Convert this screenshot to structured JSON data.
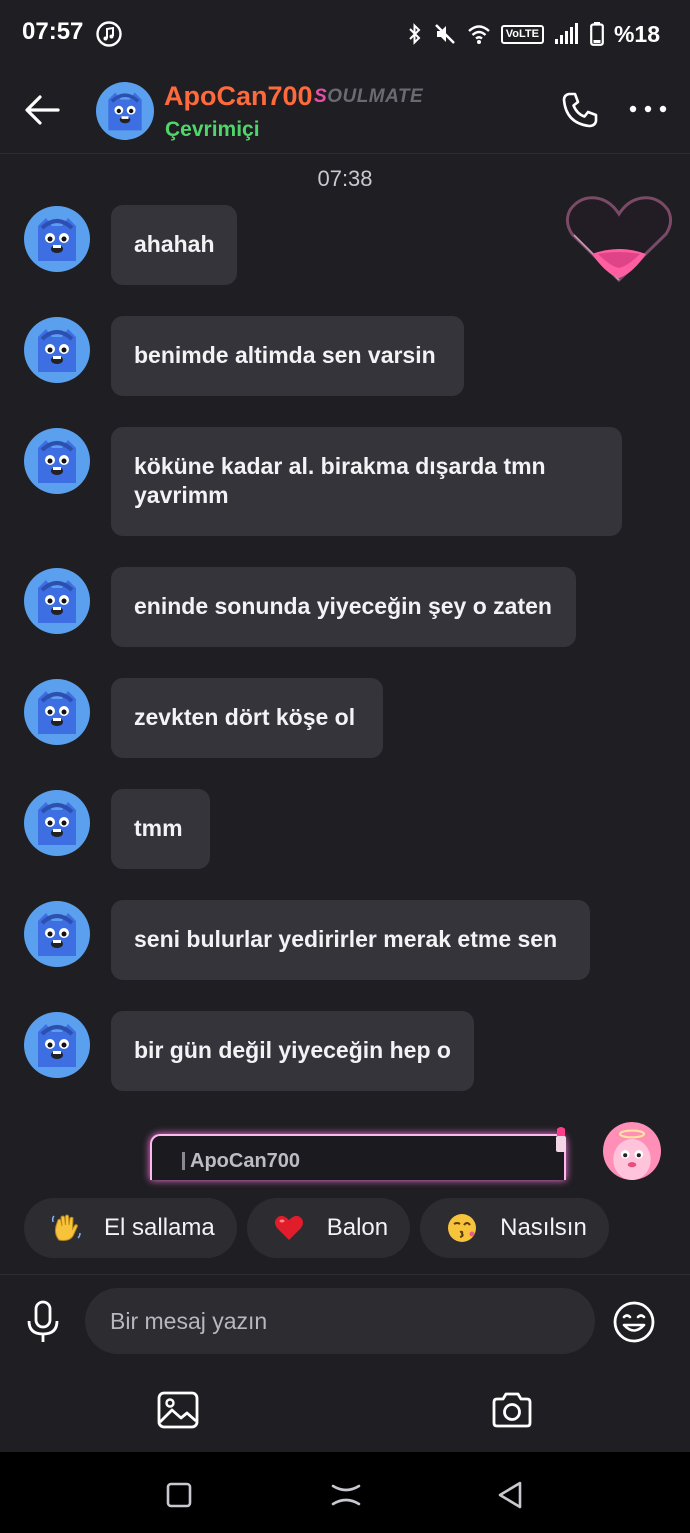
{
  "status_bar": {
    "time": "07:57",
    "icons": [
      "music-icon",
      "bluetooth-icon",
      "mute-icon",
      "wifi-icon",
      "volte-icon",
      "signal-icon",
      "battery-icon"
    ],
    "volte_label": "VoLTE",
    "battery": "%18"
  },
  "header": {
    "contact_name": "ApoCan700",
    "badge_s": "S",
    "badge_rest": "OULMATE",
    "status": "Çevrimiçi",
    "name_color": "#ff6a3d",
    "status_color": "#4fd66a"
  },
  "chat": {
    "timestamp": "07:38",
    "messages": [
      {
        "text": "ahahah"
      },
      {
        "text": "benimde altimda sen varsin"
      },
      {
        "text": "köküne kadar al. birakma dışarda tmn yavrimm"
      },
      {
        "text": "eninde sonunda yiyeceğin şey o zaten"
      },
      {
        "text": "zevkten dört köşe ol"
      },
      {
        "text": "tmm"
      },
      {
        "text": "seni  bulurlar yedirirler merak etme sen"
      },
      {
        "text": "bir gün değil yiyeceğin hep o"
      }
    ],
    "reply_preview_name": "ApoCan700"
  },
  "quick_replies": [
    {
      "label": "El sallama",
      "icon": "waving-hand-icon"
    },
    {
      "label": "Balon",
      "icon": "red-heart-icon"
    },
    {
      "label": "Nasılsın",
      "icon": "kissing-face-icon"
    }
  ],
  "composer": {
    "placeholder": "Bir mesaj yazın"
  }
}
